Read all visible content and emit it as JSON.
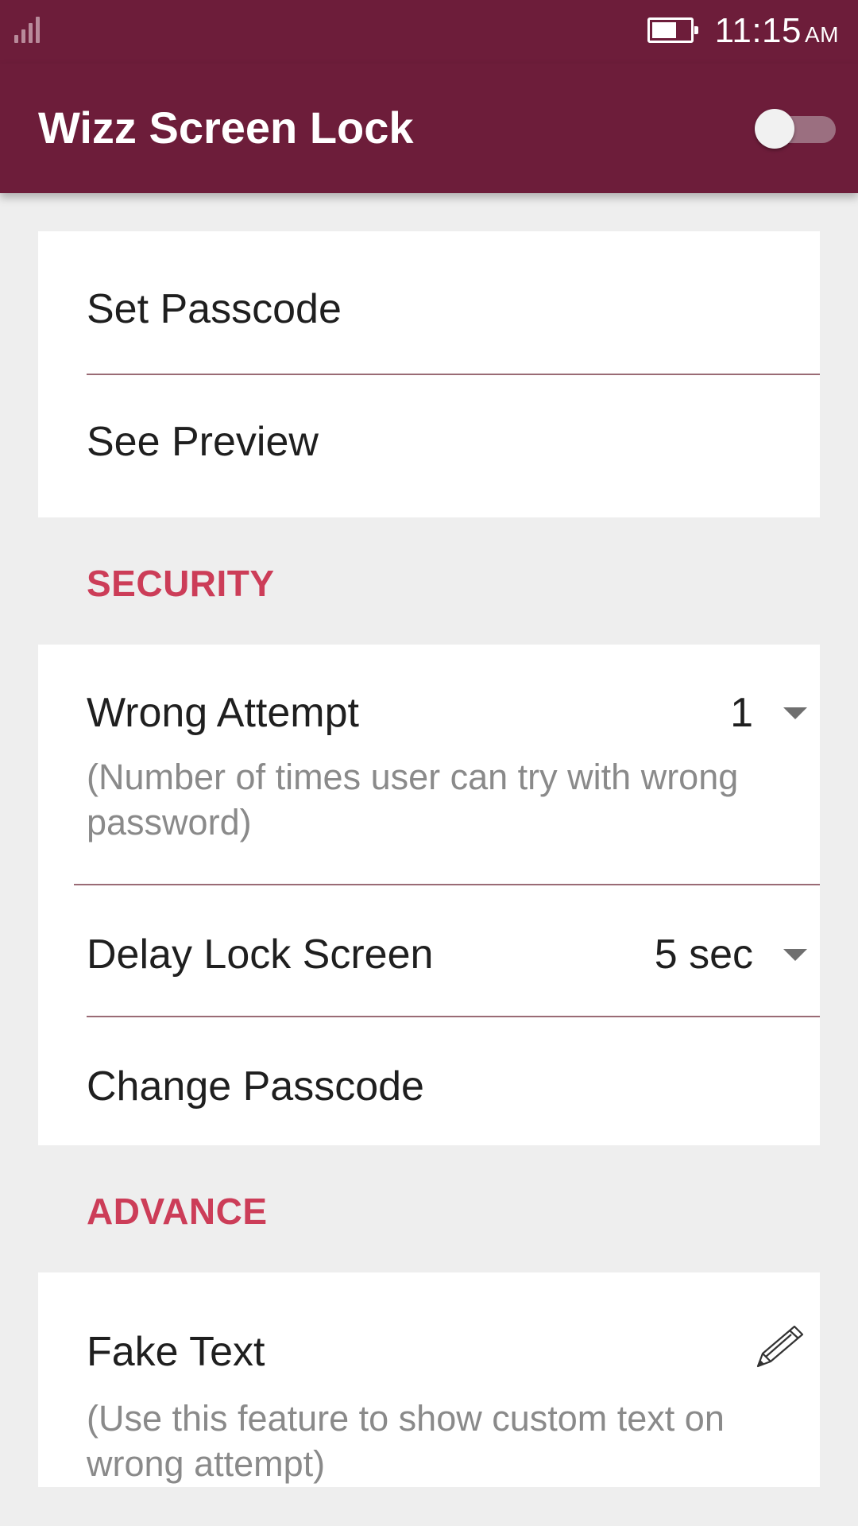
{
  "status_bar": {
    "time": "11:15",
    "ampm": "AM"
  },
  "app_bar": {
    "title": "Wizz Screen Lock"
  },
  "card_top": {
    "set_passcode": "Set Passcode",
    "see_preview": "See Preview"
  },
  "security": {
    "header": "SECURITY",
    "wrong_attempt": {
      "label": "Wrong Attempt",
      "value": "1",
      "description": "(Number of times user can try with wrong password)"
    },
    "delay_lock": {
      "label": "Delay Lock Screen",
      "value": "5 sec"
    },
    "change_passcode": "Change Passcode"
  },
  "advance": {
    "header": "ADVANCE",
    "fake_text": {
      "label": "Fake Text",
      "description": "(Use this feature to show custom text on wrong attempt)"
    }
  },
  "colors": {
    "primary": "#6d1d3a",
    "accent": "#cc3d58",
    "background": "#eeeeee"
  }
}
